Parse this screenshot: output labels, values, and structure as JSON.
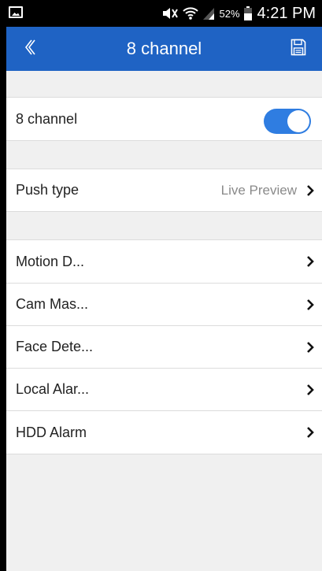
{
  "status_bar": {
    "battery_percent": "52%",
    "time": "4:21 PM"
  },
  "app_bar": {
    "title": "8 channel",
    "back_icon": "chevron-left-icon",
    "save_icon": "floppy-disk-icon"
  },
  "channel_toggle": {
    "label": "8 channel",
    "enabled": true,
    "accent": "#2f7de1"
  },
  "push_type": {
    "label": "Push type",
    "value": "Live Preview"
  },
  "alarm_items": [
    {
      "label": "Motion D..."
    },
    {
      "label": "Cam Mas..."
    },
    {
      "label": "Face Dete..."
    },
    {
      "label": "Local Alar..."
    },
    {
      "label": "HDD Alarm"
    }
  ],
  "colors": {
    "app_bar": "#1f63c4",
    "background": "#f0f0f0"
  }
}
